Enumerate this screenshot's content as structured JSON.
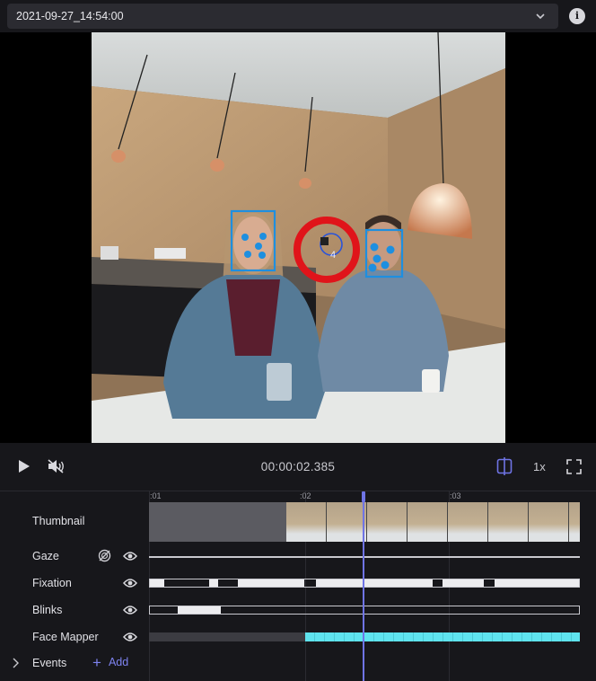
{
  "recording": {
    "selected": "2021-09-27_14:54:00"
  },
  "icons": {
    "chevron": "chevron-down-icon",
    "info": "info-icon",
    "play": "play-icon",
    "mute": "volume-muted-icon",
    "split": "split-view-icon",
    "fullscreen": "fullscreen-icon",
    "eye": "eye-icon",
    "gaze-off": "gaze-circle-icon",
    "expand": "chevron-right-icon",
    "add": "plus-icon"
  },
  "overlay": {
    "fixation_id": "4",
    "colors": {
      "gaze": "#e0141a",
      "face": "#1e8fe0",
      "accent": "#6f74e6",
      "facemapper": "#5fe3ee"
    }
  },
  "player": {
    "timecode": "00:00:02.385",
    "speed": "1x",
    "progress": 0.49
  },
  "timeline": {
    "ticks": [
      ":01",
      ":02",
      ":03"
    ],
    "rows": {
      "thumbnail": "Thumbnail",
      "gaze": "Gaze",
      "fixation": "Fixation",
      "blinks": "Blinks",
      "face_mapper": "Face Mapper",
      "events": "Events"
    },
    "add_label": "Add"
  }
}
